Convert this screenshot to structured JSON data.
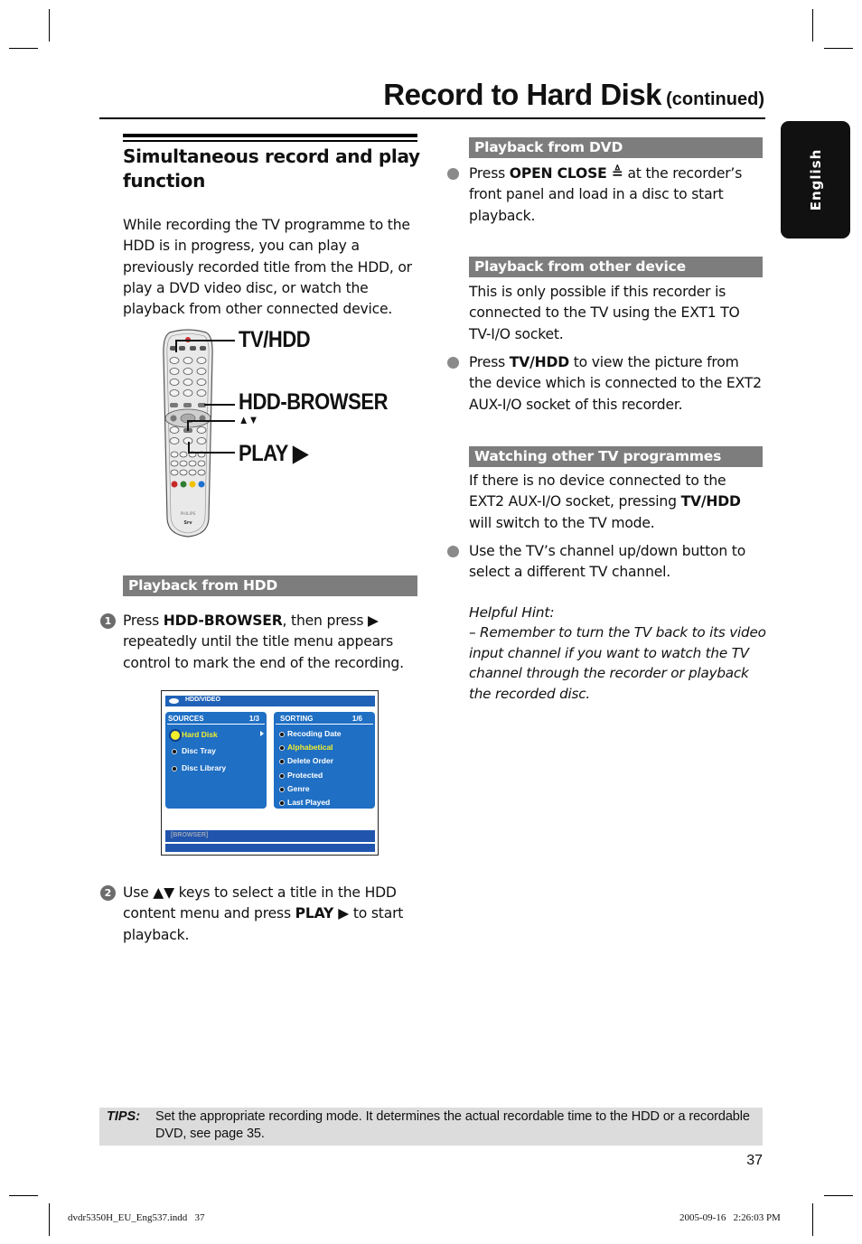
{
  "header": {
    "title": "Record to Hard Disk",
    "title_suffix": "(continued)",
    "language_tab": "English"
  },
  "left_column": {
    "heading": "Simultaneous record and play function",
    "intro": "While recording the TV programme to the HDD is in progress, you can play a previously recorded title from the HDD, or play a DVD video disc, or watch the playback from other connected device.",
    "remote_callouts": {
      "tv_hdd": "TV/HDD",
      "hdd_browser": "HDD-BROWSER",
      "up_down": "▲▼",
      "play": "PLAY ▶"
    },
    "section_hdd": {
      "title": "Playback from HDD",
      "step1": {
        "number": "1",
        "prefix": "Press ",
        "bold": "HDD-BROWSER",
        "suffix_line1": ", then press ▶",
        "rest": "repeatedly until the title menu appears control to mark the end of the recording."
      },
      "step2": {
        "number": "2",
        "prefix": "Use ▲▼ keys to select a title in the HDD content menu and press ",
        "bold": "PLAY ▶",
        "suffix": " to start playback."
      }
    },
    "osd_screen": {
      "top_bar": "HDD/VIDEO",
      "sources": {
        "header": "SOURCES",
        "page": "1/3",
        "items": [
          {
            "label": "Hard Disk",
            "selected": true
          },
          {
            "label": "Disc Tray",
            "selected": false
          },
          {
            "label": "Disc Library",
            "selected": false
          }
        ]
      },
      "sorting": {
        "header": "SORTING",
        "page": "1/6",
        "items": [
          {
            "label": "Recoding Date",
            "selected": false
          },
          {
            "label": "Alphabetical",
            "selected": true
          },
          {
            "label": "Delete Order",
            "selected": false
          },
          {
            "label": "Protected",
            "selected": false
          },
          {
            "label": "Genre",
            "selected": false
          },
          {
            "label": "Last Played",
            "selected": false
          }
        ]
      },
      "bottom_bar": "[BROWSER]",
      "colors": {
        "panel": "#1f6fc4",
        "bar": "#1f62b8",
        "selected_text": "#f2ee2a"
      }
    }
  },
  "right_column": {
    "section_dvd": {
      "title": "Playback from DVD",
      "bullet1": {
        "prefix": "Press ",
        "bold": "OPEN CLOSE ≜",
        "suffix": " at the recorder’s front panel and load in a disc to start playback."
      }
    },
    "section_other": {
      "title": "Playback from other device",
      "para": "This is only possible if this recorder is connected to the TV using the EXT1 TO TV-I/O socket.",
      "bullet1": {
        "prefix": "Press ",
        "bold": "TV/HDD",
        "suffix": " to view the picture from the device which is connected to the EXT2 AUX-I/O socket of this recorder."
      }
    },
    "section_watch": {
      "title": "Watching other TV programmes",
      "para_prefix": "If there is no device connected to the EXT2 AUX-I/O socket, pressing ",
      "para_bold": "TV/HDD",
      "para_suffix": " will switch to the TV mode.",
      "bullet1": "Use the TV’s channel up/down button to select a different TV channel."
    },
    "hint": {
      "title": "Helpful Hint:",
      "text": "–  Remember to turn the TV back to its video input channel if you want to watch the TV channel through the recorder or playback the recorded disc."
    }
  },
  "tips": {
    "label": "TIPS:",
    "text": "Set the appropriate recording mode. It determines the actual recordable time to the HDD or a recordable DVD, see page 35."
  },
  "page_number": "37",
  "footer": {
    "file": "dvdr5350H_EU_Eng537.indd   37",
    "timestamp": "2005-09-16   2:26:03 PM"
  },
  "colors": {
    "section_bar": "#7d7d7d",
    "tips_bg": "#dcdcdc",
    "language_tab_bg": "#111111"
  }
}
